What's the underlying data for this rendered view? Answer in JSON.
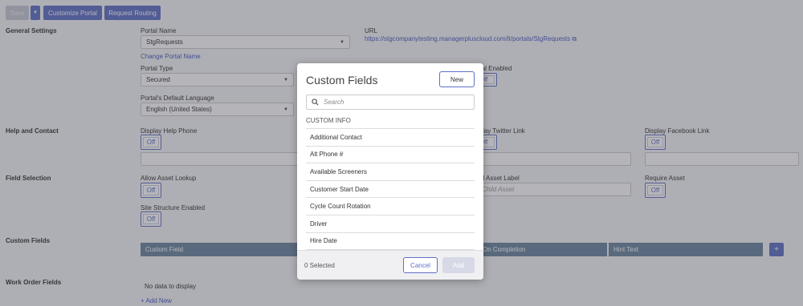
{
  "toolbar": {
    "save_label": "Save",
    "dropdown_icon": "chevron-down-icon",
    "customize_label": "Customize Portal",
    "routing_label": "Request Routing"
  },
  "general": {
    "section": "General Settings",
    "portal_name_label": "Portal Name",
    "portal_name_value": "StgRequests",
    "change_name_link": "Change Portal Name",
    "url_label": "URL",
    "url_value": "https://stgcompanytesting.managerpluscloud.com/lt/portals/StgRequests",
    "portal_type_label": "Portal Type",
    "portal_type_value": "Secured",
    "portal_enabled_label": "Portal Enabled",
    "portal_enabled_value": "Off",
    "language_label": "Portal's Default Language",
    "language_value": "English (United States)"
  },
  "help": {
    "section": "Help and Contact",
    "phone_label": "Display Help Phone",
    "phone_value": "Off",
    "twitter_label": "Display Twitter Link",
    "twitter_value": "Off",
    "facebook_label": "Display Facebook Link",
    "facebook_value": "Off"
  },
  "field_selection": {
    "section": "Field Selection",
    "asset_lookup_label": "Allow Asset Lookup",
    "asset_lookup_value": "Off",
    "child_asset_label": "Child Asset Label",
    "child_asset_placeholder": "Child Asset",
    "require_asset_label": "Require Asset",
    "require_asset_value": "Off",
    "site_structure_label": "Site Structure Enabled",
    "site_structure_value": "Off"
  },
  "custom_fields_section": {
    "section": "Custom Fields",
    "col_field": "Custom Field",
    "col_completion": "On Completion",
    "col_hint": "Hint Text",
    "add_icon": "+"
  },
  "work_order": {
    "section": "Work Order Fields",
    "empty": "No data to display",
    "add_link": "+ Add New"
  },
  "modal": {
    "title": "Custom Fields",
    "new_label": "New",
    "search_placeholder": "Search",
    "list_header": "CUSTOM INFO",
    "items": [
      "Additional Contact",
      "Alt Phone #",
      "Available Screeners",
      "Customer Start Date",
      "Cycle Count Rotation",
      "Driver",
      "Hire Date"
    ],
    "selected_text": "0 Selected",
    "cancel_label": "Cancel",
    "add_label": "Add"
  }
}
